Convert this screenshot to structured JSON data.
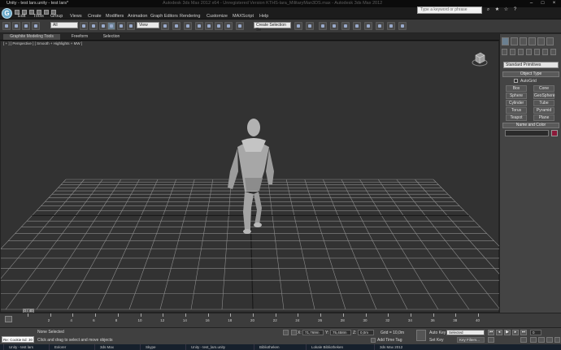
{
  "window": {
    "title": "Unity - test lars.unity - test lars*",
    "center_title": "Autodesk 3ds Max 2012 x64 - Unregistered Version   KTHS-lara_MilitaryMan3DS.max - Autodesk 3ds Max 2012",
    "min_icon": "minimize-icon",
    "max_icon": "maximize-icon",
    "close_icon": "close-icon"
  },
  "search": {
    "placeholder": "Type a keyword or phrase"
  },
  "menu": [
    "Edit",
    "Tools",
    "Group",
    "Views",
    "Create",
    "Modifiers",
    "Animation",
    "Graph Editors",
    "Rendering",
    "Customize",
    "MAXScript",
    "Help"
  ],
  "toolbar": {
    "selection_filter": "All",
    "ref_coord": "View",
    "named_selection": "Create Selection Se"
  },
  "ribbon": {
    "tabs": [
      "Graphite Modeling Tools",
      "Freeform",
      "Selection"
    ]
  },
  "viewport": {
    "label": "[ + ] [ Perspective ] [ Smooth + Highlights + MW ]",
    "colors": {
      "bg": "#323232",
      "grid": "#8d8d8d",
      "center_line": "#1a1a1a"
    }
  },
  "command_panel": {
    "category": "Standard Primitives",
    "object_type_title": "Object Type",
    "autogrid": "AutoGrid",
    "buttons": [
      "Box",
      "Cone",
      "Sphere",
      "GeoSphere",
      "Cylinder",
      "Tube",
      "Torus",
      "Pyramid",
      "Teapot",
      "Plane"
    ],
    "name_color_title": "Name and Color",
    "swatch_color": "#8c1a3a"
  },
  "timeline": {
    "slider_label": "0 / 40",
    "ticks": [
      0,
      2,
      4,
      6,
      8,
      10,
      12,
      14,
      16,
      18,
      20,
      22,
      24,
      26,
      28,
      30,
      32,
      34,
      36,
      38,
      40
    ]
  },
  "status": {
    "maxscript_label": "Re: Cookie",
    "maxscript_info": "Sd: 30",
    "selection": "None Selected",
    "prompt": "Click and drag to select and move objects",
    "x_label": "X:",
    "x_value": "71,769m",
    "y_label": "Y:",
    "y_value": "75,458m",
    "z_label": "Z:",
    "z_value": "0,0m",
    "grid": "Grid = 10,0m",
    "add_time_tag": "Add Time Tag",
    "auto_key": "Auto Key",
    "set_key": "Set Key",
    "key_mode": "Selected",
    "key_filters": "Key Filters...",
    "frame": "0"
  },
  "taskbar": [
    "Unity - test lars",
    "Exlorer",
    "3ds Max",
    "Skype",
    "Unity - test_lars.unity",
    "Bibliotheken",
    "Lokale Bibliotheken",
    "3ds Max 2012"
  ]
}
